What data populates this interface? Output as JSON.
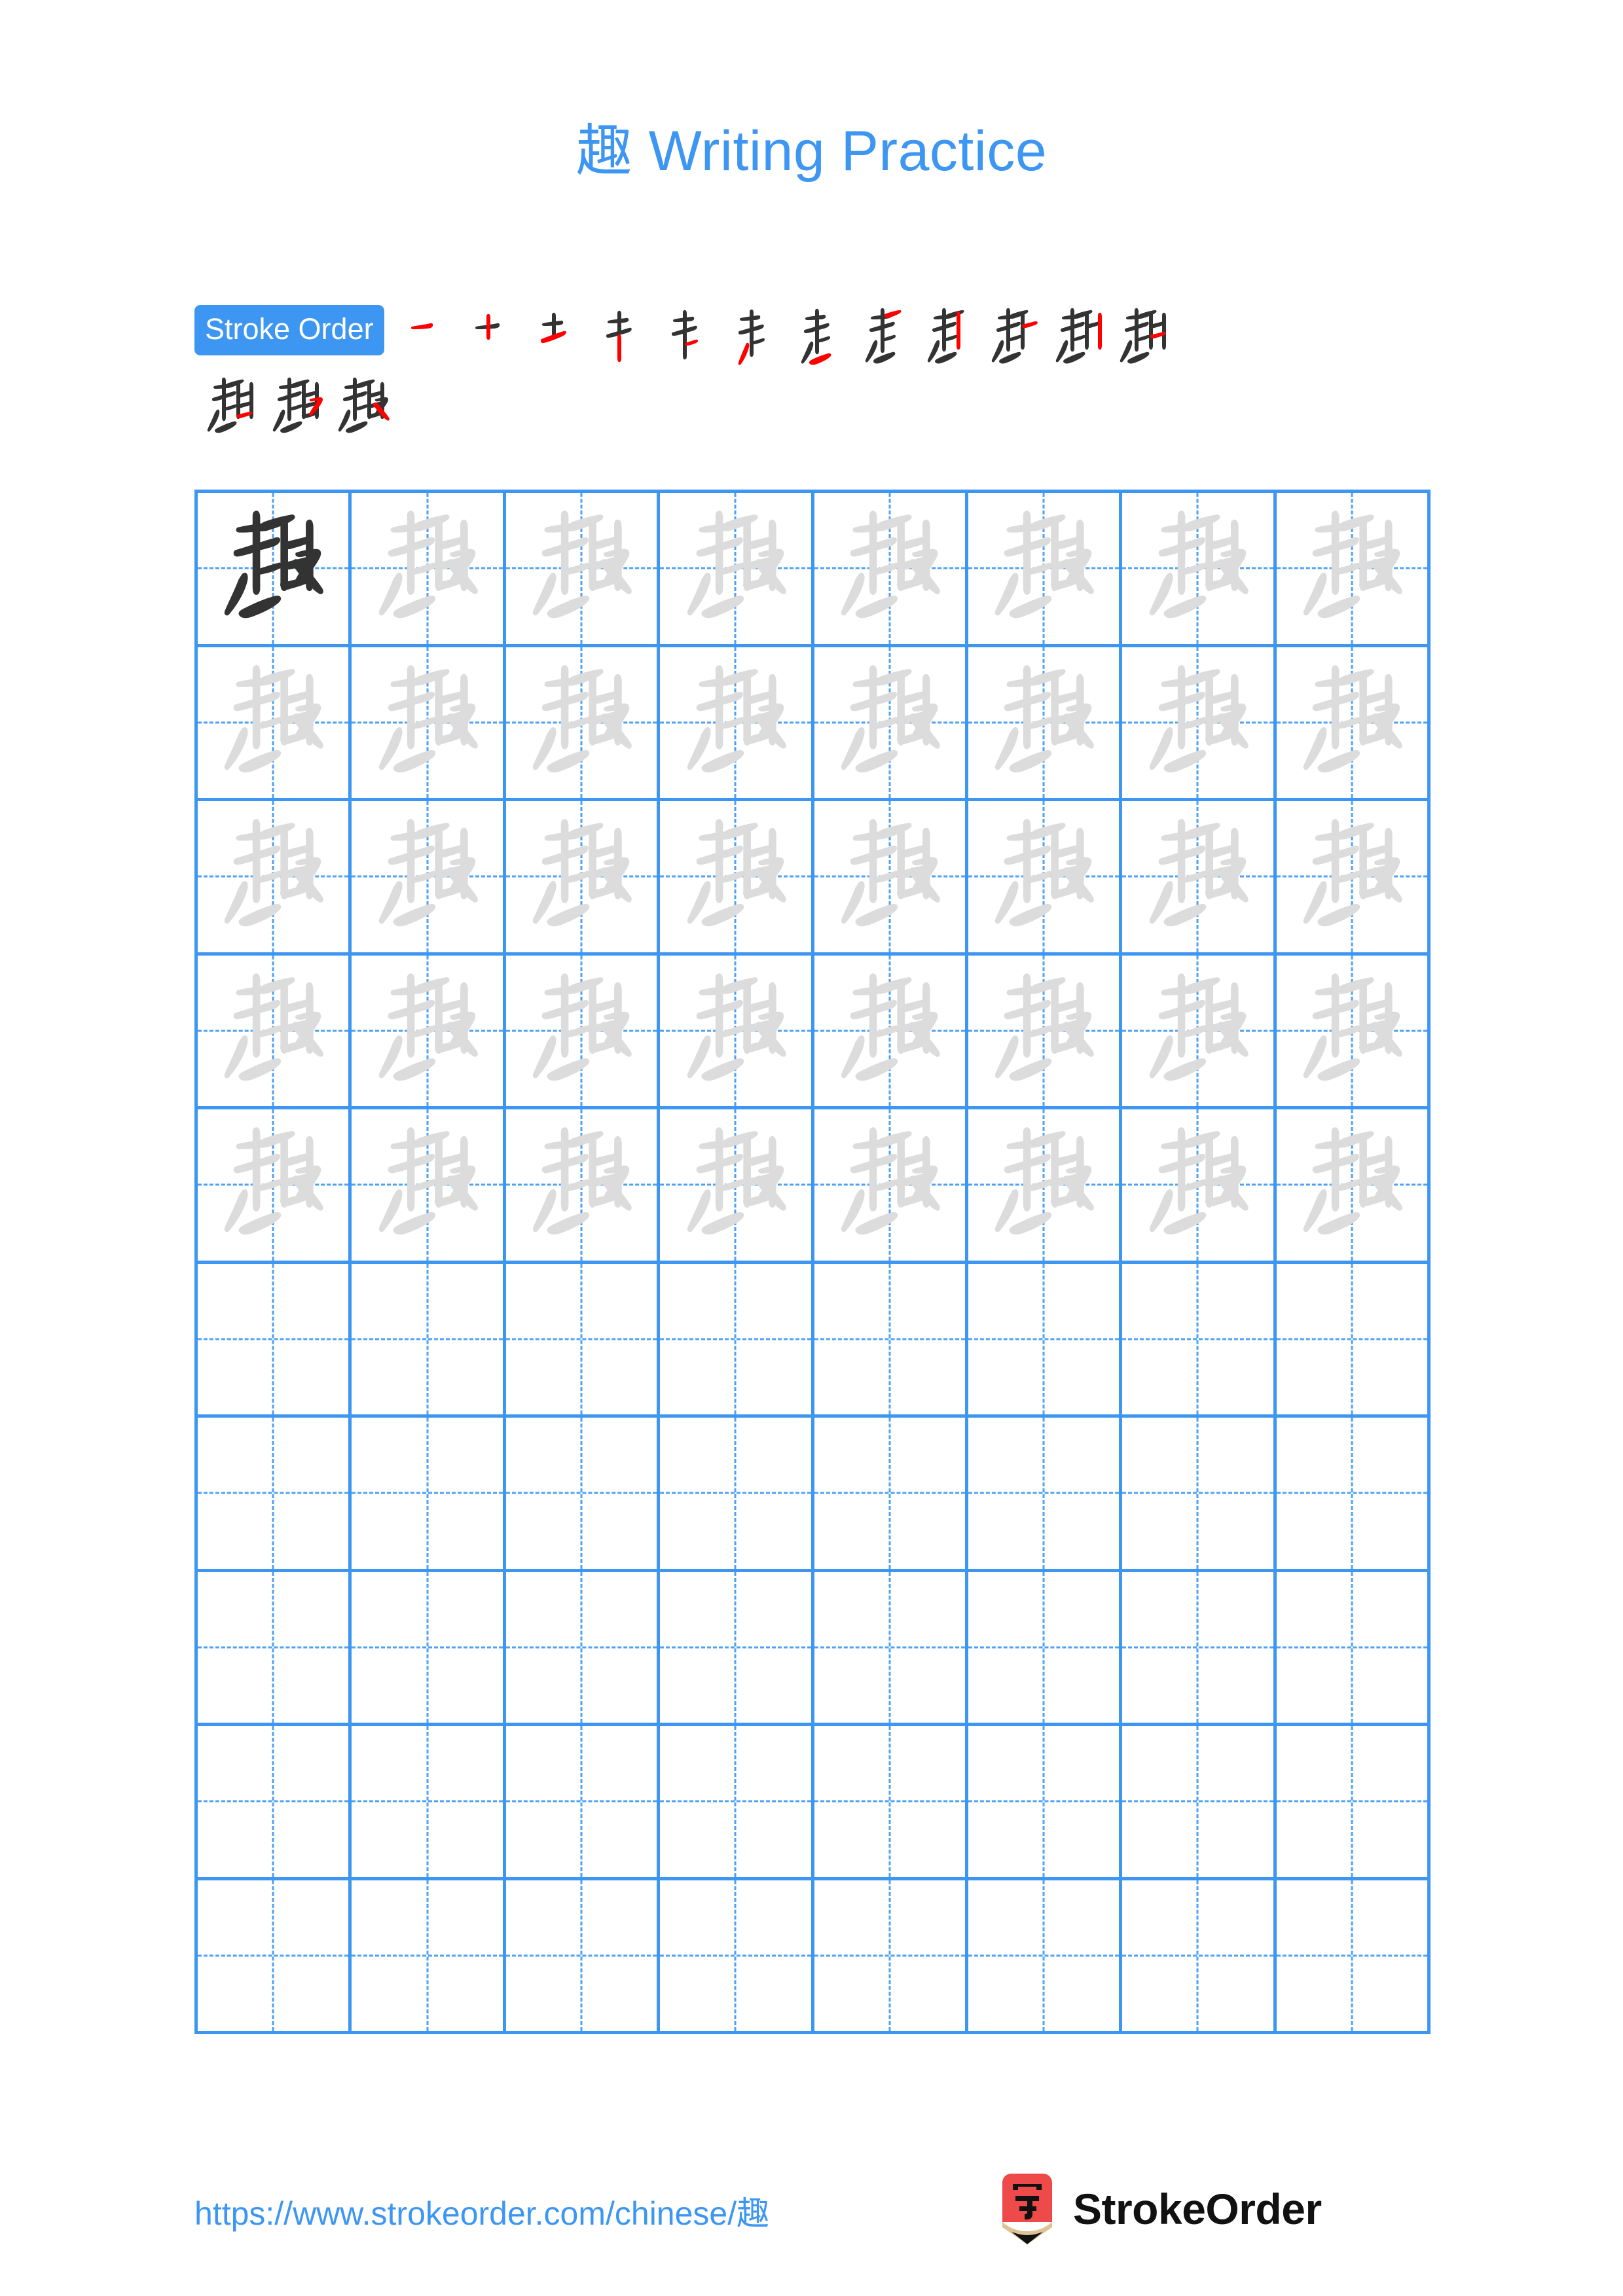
{
  "document": {
    "character": "趣",
    "title_character": "趣",
    "title_text": " Writing Practice",
    "title_full": "趣 Writing Practice",
    "accent_color": "#3d96f2",
    "guide_color": "#4ea2f5",
    "faint_glyph_color": "#dcdcdc",
    "dark_glyph_color": "#333333",
    "stroke_highlight_color": "#ff0000",
    "background_color": "#ffffff"
  },
  "stroke_order": {
    "badge_label": "Stroke Order",
    "total_strokes": 15,
    "row1_count": 12,
    "row2_count": 3,
    "steps": [
      {
        "index": 1,
        "label": "stroke-1"
      },
      {
        "index": 2,
        "label": "stroke-2"
      },
      {
        "index": 3,
        "label": "stroke-3"
      },
      {
        "index": 4,
        "label": "stroke-4"
      },
      {
        "index": 5,
        "label": "stroke-5"
      },
      {
        "index": 6,
        "label": "stroke-6"
      },
      {
        "index": 7,
        "label": "stroke-7"
      },
      {
        "index": 8,
        "label": "stroke-8"
      },
      {
        "index": 9,
        "label": "stroke-9"
      },
      {
        "index": 10,
        "label": "stroke-10"
      },
      {
        "index": 11,
        "label": "stroke-11"
      },
      {
        "index": 12,
        "label": "stroke-12"
      },
      {
        "index": 13,
        "label": "stroke-13"
      },
      {
        "index": 14,
        "label": "stroke-14"
      },
      {
        "index": 15,
        "label": "stroke-15"
      }
    ]
  },
  "practice_grid": {
    "columns": 8,
    "rows": 10,
    "filled_rows": 5,
    "empty_rows": 5,
    "dark_cell_index": 0,
    "cell_character": "趣"
  },
  "footer": {
    "url": "https://www.strokeorder.com/chinese/趣",
    "brand_name": "StrokeOrder",
    "logo_character": "字",
    "logo_body_color": "#ef4a4a",
    "logo_wood_color": "#dec296",
    "logo_tip_color": "#111111"
  }
}
